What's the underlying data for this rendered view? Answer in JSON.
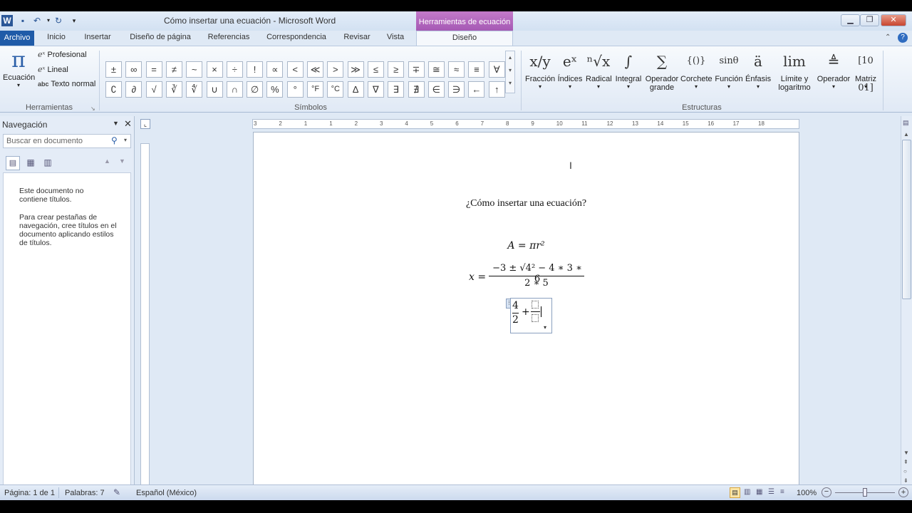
{
  "window": {
    "title": "Cómo insertar una ecuación  -  Microsoft Word",
    "contextual_tab_group": "Herramientas de ecuación"
  },
  "tabs": [
    "Archivo",
    "Inicio",
    "Insertar",
    "Diseño de página",
    "Referencias",
    "Correspondencia",
    "Revisar",
    "Vista",
    "Diseño"
  ],
  "ribbon": {
    "herramientas": {
      "ecuacion_label": "Ecuación",
      "profesional": "Profesional",
      "lineal": "Lineal",
      "texto_normal": "Texto normal",
      "group_label": "Herramientas"
    },
    "simbolos": {
      "row1": [
        "±",
        "∞",
        "=",
        "≠",
        "~",
        "×",
        "÷",
        "!",
        "∝",
        "<",
        "≪",
        ">",
        "≫",
        "≤",
        "≥",
        "∓",
        "≅",
        "≈",
        "≡",
        "∀"
      ],
      "row2": [
        "∁",
        "∂",
        "√",
        "∛",
        "∜",
        "∪",
        "∩",
        "∅",
        "%",
        "°",
        "°F",
        "°C",
        "∆",
        "∇",
        "∃",
        "∄",
        "∈",
        "∋",
        "←",
        "↑"
      ],
      "group_label": "Símbolos"
    },
    "estructuras": {
      "items": [
        {
          "label": "Fracción",
          "glyph": "x/y"
        },
        {
          "label": "Índices",
          "glyph": "eˣ"
        },
        {
          "label": "Radical",
          "glyph": "ⁿ√x"
        },
        {
          "label": "Integral",
          "glyph": "∫"
        },
        {
          "label": "Operador",
          "label2": "grande",
          "glyph": "∑"
        },
        {
          "label": "Corchete",
          "glyph": "{()}"
        },
        {
          "label": "Función",
          "glyph": "sinθ"
        },
        {
          "label": "Énfasis",
          "glyph": "ä"
        },
        {
          "label": "Límite y",
          "label2": "logaritmo",
          "glyph": "lim"
        },
        {
          "label": "Operador",
          "glyph": "≜"
        },
        {
          "label": "Matriz",
          "glyph": "[10 01]"
        }
      ],
      "group_label": "Estructuras"
    }
  },
  "navigation": {
    "title": "Navegación",
    "search_placeholder": "Buscar en documento",
    "msg1": "Este documento no contiene títulos.",
    "msg2": "Para crear pestañas de navegación, cree títulos en el documento aplicando estilos de títulos."
  },
  "document": {
    "heading": "¿Cómo insertar una ecuación?",
    "eq1": "A = πr²",
    "eq2_lhs": "x =",
    "eq2_num": "−3 ± √4² − 4 ∗ 3 ∗ 6",
    "eq2_den": "2 ∗ 5",
    "eq3_num": "4",
    "eq3_den": "2",
    "eq3_op": "+"
  },
  "ruler": {
    "numbers": [
      "3",
      "2",
      "1",
      "1",
      "2",
      "3",
      "4",
      "5",
      "6",
      "7",
      "8",
      "9",
      "10",
      "11",
      "12",
      "13",
      "14",
      "15",
      "16",
      "17",
      "18"
    ]
  },
  "status": {
    "page": "Página: 1 de 1",
    "words": "Palabras: 7",
    "language": "Español (México)",
    "zoom": "100%"
  }
}
